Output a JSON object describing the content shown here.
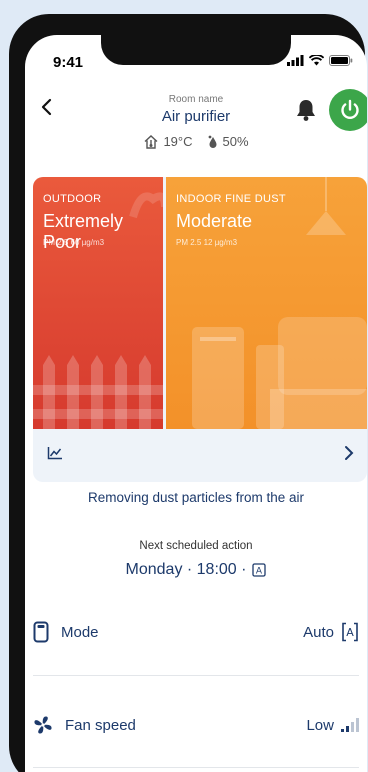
{
  "status_bar": {
    "time": "9:41"
  },
  "header": {
    "room_label": "Room name",
    "title": "Air purifier",
    "temperature": "19°C",
    "humidity": "50%"
  },
  "air_quality": {
    "outdoor": {
      "tag": "OUTDOOR",
      "level": "Extremely Poor",
      "pm": "PM 2.5 60 µg/m3",
      "color": "#e04a35"
    },
    "indoor": {
      "tag": "INDOOR FINE DUST",
      "level": "Moderate",
      "pm": "PM 2.5 12 µg/m3",
      "color": "#f59a30"
    }
  },
  "status_text": "Removing dust particles from the air",
  "schedule": {
    "label": "Next scheduled action",
    "value": "Monday · 18:00 ·"
  },
  "settings": [
    {
      "label": "Mode",
      "value": "Auto",
      "icon": "purifier-icon"
    },
    {
      "label": "Fan speed",
      "value": "Low",
      "icon": "fan-icon"
    }
  ],
  "colors": {
    "accent": "#1d3a6b",
    "power": "#3ca64a"
  }
}
